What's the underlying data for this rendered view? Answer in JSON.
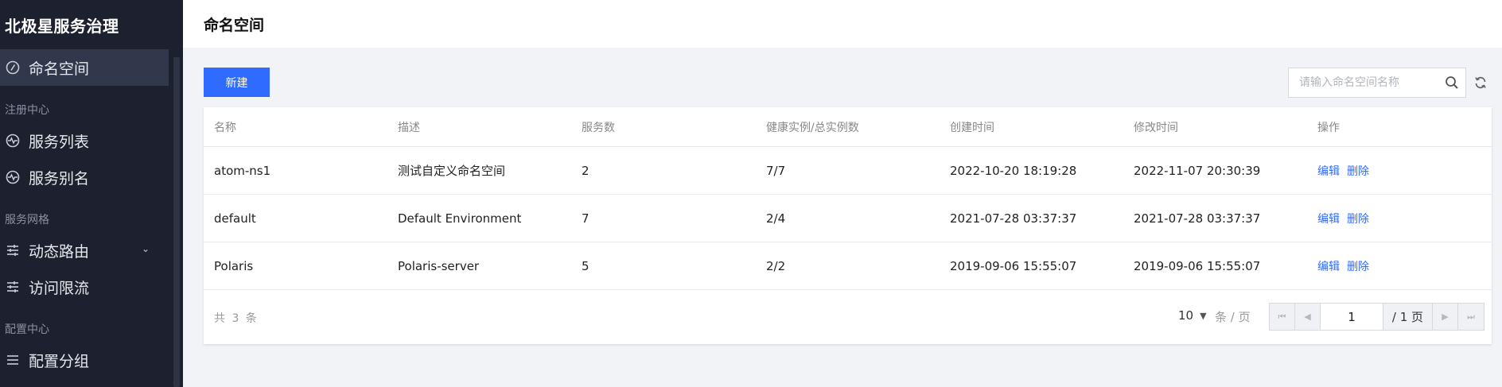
{
  "sidebar": {
    "brand": "北极星服务治理",
    "items": [
      {
        "label": "命名空间",
        "icon": "namespace-icon",
        "active": true
      },
      {
        "group": "注册中心"
      },
      {
        "label": "服务列表",
        "icon": "service-list-icon"
      },
      {
        "label": "服务别名",
        "icon": "service-alias-icon"
      },
      {
        "group": "服务网格"
      },
      {
        "label": "动态路由",
        "icon": "sliders-icon",
        "expandable": true
      },
      {
        "label": "访问限流",
        "icon": "sliders-icon"
      },
      {
        "group": "配置中心"
      },
      {
        "label": "配置分组",
        "icon": "list-icon"
      }
    ]
  },
  "header": {
    "title": "命名空间"
  },
  "toolbar": {
    "new_label": "新建",
    "search_placeholder": "请输入命名空间名称"
  },
  "table": {
    "columns": [
      "名称",
      "描述",
      "服务数",
      "健康实例/总实例数",
      "创建时间",
      "修改时间",
      "操作"
    ],
    "rows": [
      {
        "name": "atom-ns1",
        "desc": "测试自定义命名空间",
        "services": "2",
        "health": "7/7",
        "created": "2022-10-20 18:19:28",
        "modified": "2022-11-07 20:30:39"
      },
      {
        "name": "default",
        "desc": "Default Environment",
        "services": "7",
        "health": "2/4",
        "created": "2021-07-28 03:37:37",
        "modified": "2021-07-28 03:37:37"
      },
      {
        "name": "Polaris",
        "desc": "Polaris-server",
        "services": "5",
        "health": "2/2",
        "created": "2019-09-06 15:55:07",
        "modified": "2019-09-06 15:55:07"
      }
    ],
    "action_edit": "编辑",
    "action_delete": "删除"
  },
  "footer": {
    "total": "共 3 条",
    "page_size": "10",
    "page_size_unit": "条 / 页",
    "current_page": "1",
    "total_pages": "/ 1 页"
  },
  "colors": {
    "accent": "#2f6bff",
    "sidebar_bg": "#1d212f",
    "sidebar_active": "#32384b"
  }
}
